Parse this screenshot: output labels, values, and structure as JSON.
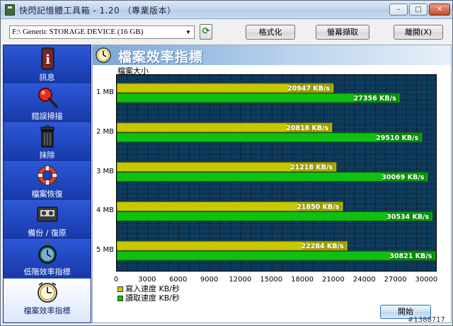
{
  "window": {
    "title": "快閃記憶體工具箱 - 1.20 （專業版本）",
    "minimize_glyph": "–",
    "maximize_glyph": "□",
    "close_glyph": "✕"
  },
  "toolbar": {
    "device_value": "F:\\ Generic STORAGE DEVICE (16 GB)",
    "dropdown_glyph": "▼",
    "refresh_glyph": "⟳",
    "format_label": "格式化",
    "capture_label": "螢幕擷取",
    "exit_label": "離開(X)"
  },
  "sidebar": {
    "items": [
      {
        "label": "訊息",
        "icon": "info-icon"
      },
      {
        "label": "錯誤掃描",
        "icon": "magnifier-icon"
      },
      {
        "label": "抹除",
        "icon": "trash-can-icon"
      },
      {
        "label": "檔案恢復",
        "icon": "life-ring-icon"
      },
      {
        "label": "備份 / 復原",
        "icon": "tape-icon"
      },
      {
        "label": "低階效率指標",
        "icon": "stopwatch-icon"
      },
      {
        "label": "檔案效率指標",
        "icon": "clock-icon"
      }
    ]
  },
  "main": {
    "title": "檔案效率指標",
    "header_icon": "clock-icon",
    "size_axis_label": "檔案大小",
    "start_label": "開始"
  },
  "colors": {
    "write": "#c8c800",
    "read": "#10c010",
    "plot_bg": "#0f3b5c",
    "sidebar_bg": "#1c3fae"
  },
  "chart_data": {
    "type": "bar",
    "orientation": "horizontal",
    "categories": [
      "1 MB",
      "2 MB",
      "3 MB",
      "4 MB",
      "5 MB"
    ],
    "series": [
      {
        "name": "寫入速度 KB/秒",
        "values": [
          20947,
          20818,
          21218,
          21850,
          22284
        ],
        "labels": [
          "20947 KB/s",
          "20818 KB/s",
          "21218 KB/s",
          "21850 KB/s",
          "22284 KB/s"
        ]
      },
      {
        "name": "讀取速度 KB/秒",
        "values": [
          27356,
          29510,
          30069,
          30534,
          30821
        ],
        "labels": [
          "27356 KB/s",
          "29510 KB/s",
          "30069 KB/s",
          "30534 KB/s",
          "30821 KB/s"
        ]
      }
    ],
    "xticks": [
      "0",
      "3000",
      "6000",
      "9000",
      "12000",
      "15000",
      "18000",
      "21000",
      "24000",
      "27000",
      "30000"
    ],
    "xlim": [
      0,
      31000
    ],
    "ylabel": "檔案大小",
    "grid": true,
    "legend": "bottom-left"
  },
  "watermark": "#1388717"
}
